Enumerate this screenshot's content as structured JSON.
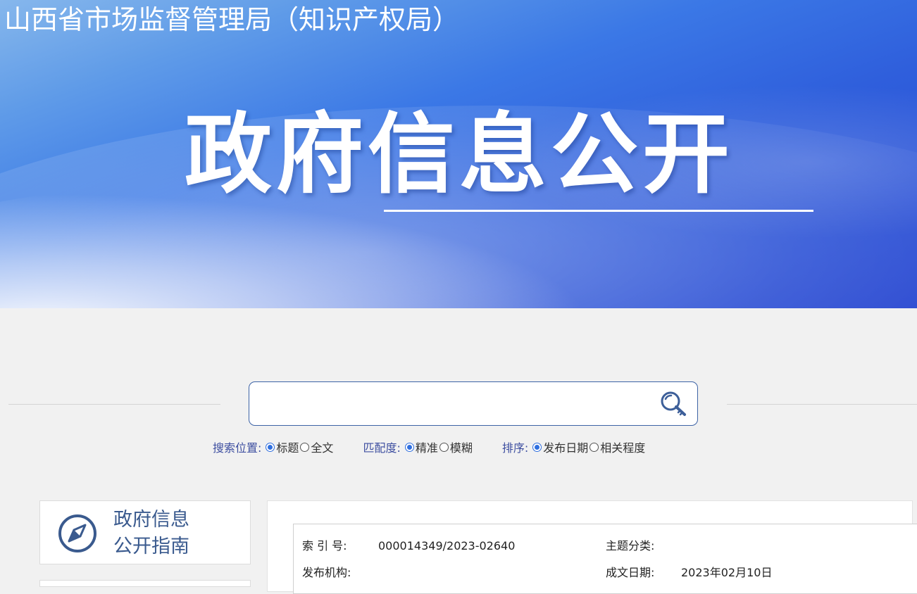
{
  "header": {
    "site_title": "山西省市场监督管理局（知识产权局）",
    "hero_title": "政府信息公开"
  },
  "search": {
    "placeholder": "",
    "value": "",
    "button_icon": "search-key-icon",
    "options": {
      "position_label": "搜索位置:",
      "position_choices": [
        {
          "label": "标题",
          "checked": true
        },
        {
          "label": "全文",
          "checked": false
        }
      ],
      "match_label": "匹配度:",
      "match_choices": [
        {
          "label": "精准",
          "checked": true
        },
        {
          "label": "模糊",
          "checked": false
        }
      ],
      "sort_label": "排序:",
      "sort_choices": [
        {
          "label": "发布日期",
          "checked": true
        },
        {
          "label": "相关程度",
          "checked": false
        }
      ]
    }
  },
  "sidebar": {
    "guide": {
      "icon": "compass-icon",
      "line1": "政府信息",
      "line2": "公开指南"
    }
  },
  "metadata": {
    "index_label": "索 引 号:",
    "index_value": "000014349/2023-02640",
    "topic_label": "主题分类:",
    "topic_value": "",
    "publisher_label": "发布机构:",
    "publisher_value": "",
    "date_label": "成文日期:",
    "date_value": "2023年02月10日"
  },
  "colors": {
    "banner_blue": "#2f5fdc",
    "label_blue": "#3d4ea0",
    "guide_text": "#3a5a8e",
    "radio_checked": "#2f6fdf",
    "search_border": "#3d63a6",
    "page_bg": "#f1f1f1"
  }
}
